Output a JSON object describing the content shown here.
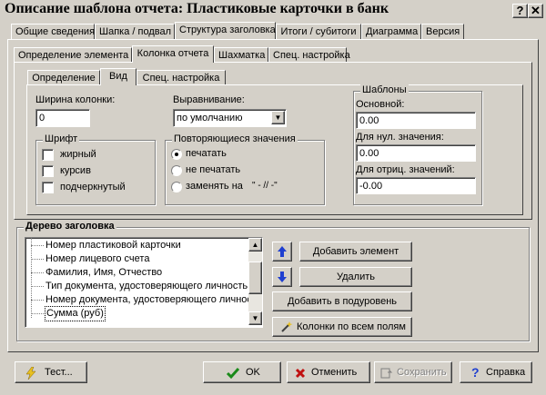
{
  "window": {
    "title": "Описание шаблона отчета: Пластиковые карточки в банк",
    "help_glyph": "?",
    "close_glyph": "✕"
  },
  "tabs_top": [
    {
      "label": "Общие сведения"
    },
    {
      "label": "Шапка / подвал"
    },
    {
      "label": "Структура заголовка"
    },
    {
      "label": "Итоги / субитоги"
    },
    {
      "label": "Диаграмма"
    },
    {
      "label": "Версия"
    }
  ],
  "tabs_mid": [
    {
      "label": "Определение элемента"
    },
    {
      "label": "Колонка отчета"
    },
    {
      "label": "Шахматка"
    },
    {
      "label": "Спец. настройка"
    }
  ],
  "tabs_inner": [
    {
      "label": "Определение"
    },
    {
      "label": "Вид"
    },
    {
      "label": "Спец. настройка"
    }
  ],
  "view": {
    "width_label": "Ширина колонки:",
    "width_value": "0",
    "align_label": "Выравнивание:",
    "align_value": "по умолчанию",
    "font_group": "Шрифт",
    "font_bold": "жирный",
    "font_italic": "курсив",
    "font_underline": "подчеркнутый",
    "repeat_group": "Повторяющиеся значения",
    "repeat_print": "печатать",
    "repeat_noprint": "не печатать",
    "repeat_replace": "заменять на",
    "repeat_replace_value": "\" - // -\"",
    "templates_group": "Шаблоны",
    "tpl_main_label": "Основной:",
    "tpl_main_value": "0.00",
    "tpl_zero_label": "Для нул. значения:",
    "tpl_zero_value": "0.00",
    "tpl_neg_label": "Для отриц. значений:",
    "tpl_neg_value": "-0.00"
  },
  "tree": {
    "group_title": "Дерево заголовка",
    "items": [
      {
        "label": "Номер пластиковой карточки"
      },
      {
        "label": "Номер лицевого счета"
      },
      {
        "label": "Фамилия, Имя, Отчество"
      },
      {
        "label": "Тип документа, удостоверяющего личность в"
      },
      {
        "label": "Номер документа, удостоверяющего личность"
      },
      {
        "label": "Сумма (руб)"
      }
    ],
    "add_element": "Добавить элемент",
    "delete": "Удалить",
    "add_sublevel": "Добавить в подуровень",
    "columns_all": "Колонки по всем полям"
  },
  "footer": {
    "test": "Тест...",
    "ok": "OK",
    "cancel": "Отменить",
    "save": "Сохранить",
    "help": "Справка"
  },
  "colors": {
    "face": "#d4d0c8",
    "arrow_blue": "#1f3fd0",
    "check_green": "#1a8a1a",
    "cross_red": "#c01010"
  }
}
